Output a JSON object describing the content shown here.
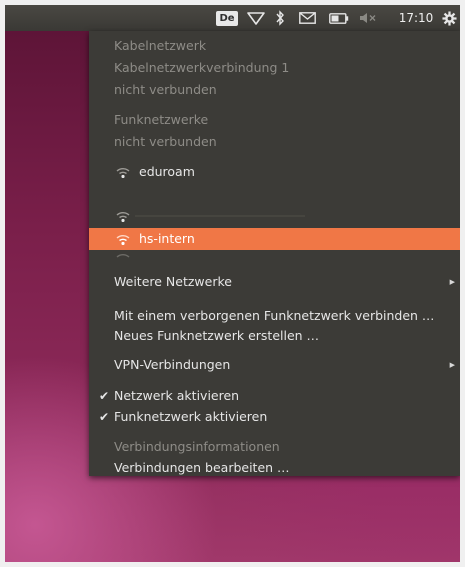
{
  "panel": {
    "keyboard_layout": "De",
    "clock": "17:10",
    "icons": [
      "network-wireless-icon",
      "bluetooth-icon",
      "mail-icon",
      "battery-icon",
      "volume-muted-icon",
      "system-gear-icon"
    ]
  },
  "menu": {
    "wired_header": "Kabelnetzwerk",
    "wired_connection": "Kabelnetzwerkverbindung 1",
    "wired_status": "nicht verbunden",
    "wireless_header": "Funknetzwerke",
    "wireless_status": "nicht verbunden",
    "networks": [
      {
        "name": "eduroam",
        "selected": false
      },
      {
        "name": "",
        "selected": false
      },
      {
        "name": "hs-intern",
        "selected": true
      },
      {
        "name": "",
        "selected": false
      }
    ],
    "more_networks": "Weitere Netzwerke",
    "connect_hidden": "Mit einem verborgenen Funknetzwerk verbinden …",
    "new_network": "Neues Funknetzwerk erstellen …",
    "vpn": "VPN-Verbindungen",
    "enable_network": "Netzwerk aktivieren",
    "enable_wireless": "Funknetzwerk aktivieren",
    "connection_info": "Verbindungsinformationen",
    "edit_connections": "Verbindungen bearbeiten …"
  },
  "colors": {
    "panel_bg": "#3c3b37",
    "highlight": "#f07746",
    "desktop": "#7a1f4a"
  }
}
